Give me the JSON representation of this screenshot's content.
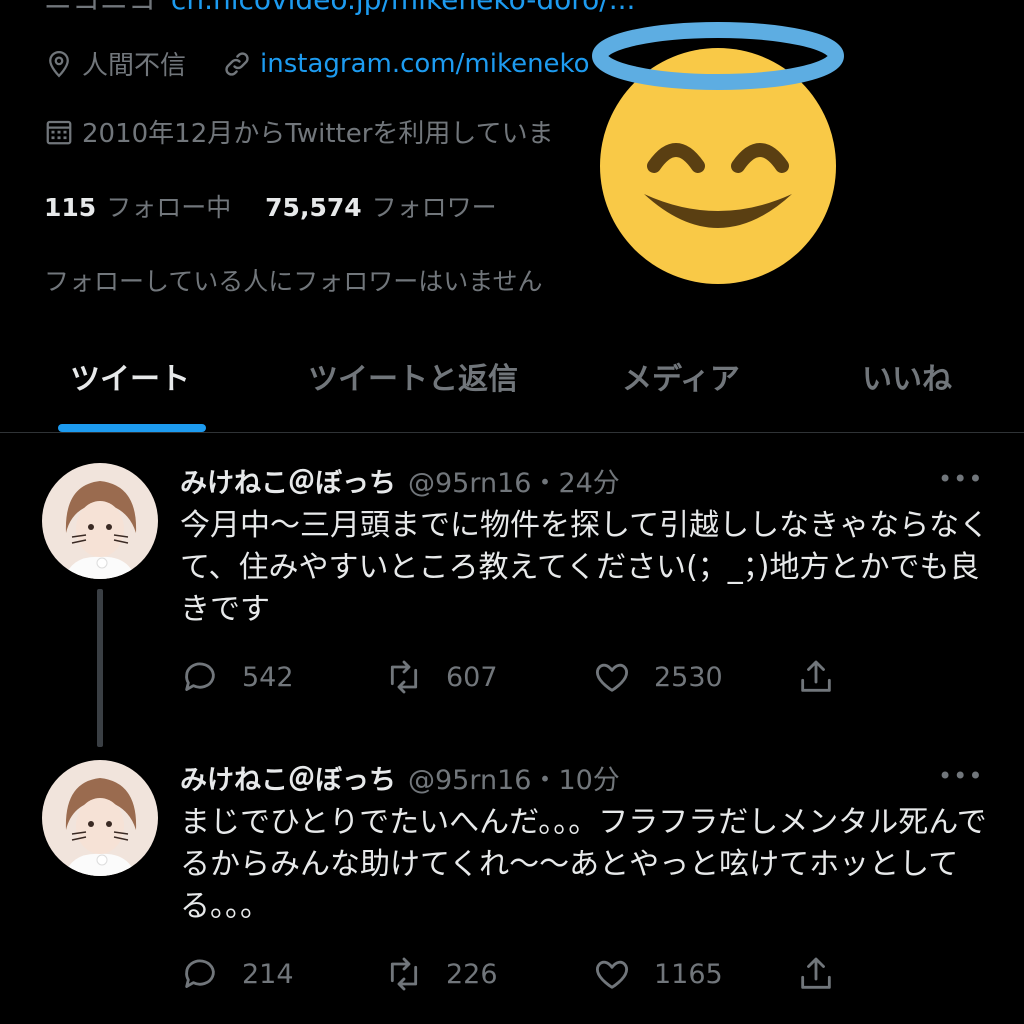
{
  "profile": {
    "nico_prefix": "ニコニコ",
    "nico_link": "ch.nicovideo.jp/mikeneko-doro/...",
    "location": "人間不信",
    "website": "instagram.com/mikeneko",
    "joined": "2010年12月からTwitterを利用していま",
    "following_count": "115",
    "following_label": "フォロー中",
    "followers_count": "75,574",
    "followers_label": "フォロワー",
    "followers_you_know": "フォローしている人にフォロワーはいません"
  },
  "tabs": [
    {
      "label": "ツイート",
      "active": true
    },
    {
      "label": "ツイートと返信",
      "active": false
    },
    {
      "label": "メディア",
      "active": false
    },
    {
      "label": "いいね",
      "active": false
    }
  ],
  "tweets": [
    {
      "name": "みけねこ＠ぼっち",
      "handle": "@95rn16・24分",
      "more": "•••",
      "text": "今月中〜三月頭までに物件を探して引越ししなきゃならなくて、住みやすいところ教えてください(；_；)地方とかでも良きです",
      "replies": "542",
      "retweets": "607",
      "likes": "2530"
    },
    {
      "name": "みけねこ＠ぼっち",
      "handle": "@95rn16・10分",
      "more": "•••",
      "text": "まじでひとりでたいへんだ。。。フラフラだしメンタル死んでるからみんな助けてくれ〜〜あとやっと呟けてホッとしてる。。。",
      "replies": "214",
      "retweets": "226",
      "likes": "1165"
    }
  ],
  "icons": [
    "location-icon",
    "link-icon",
    "calendar-icon",
    "reply-icon",
    "retweet-icon",
    "like-icon",
    "share-icon",
    "more-icon",
    "halo-smile-emoji"
  ],
  "colors": {
    "background": "#000000",
    "text": "#e7e9ea",
    "muted": "#71767b",
    "accent": "#1d9bf0",
    "emoji": "#f9c947",
    "halo": "#5dade2"
  }
}
